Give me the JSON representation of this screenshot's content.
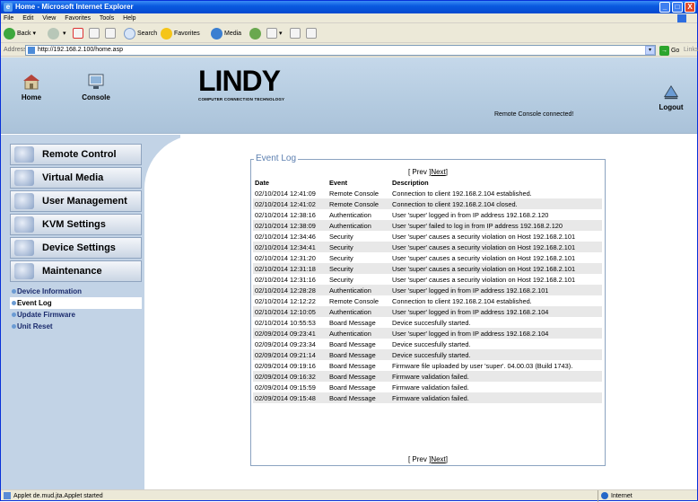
{
  "window": {
    "title": "Home - Microsoft Internet Explorer",
    "min": "_",
    "max": "□",
    "close": "X"
  },
  "menubar": [
    "File",
    "Edit",
    "View",
    "Favorites",
    "Tools",
    "Help"
  ],
  "toolbar": {
    "back": "Back",
    "search": "Search",
    "favorites": "Favorites",
    "media": "Media"
  },
  "address": {
    "label": "Address",
    "url": "http://192.168.2.100/home.asp",
    "go": "Go",
    "links": "Links"
  },
  "header": {
    "home": "Home",
    "console": "Console",
    "logo": "LINDY",
    "logo_sub": "COMPUTER CONNECTION TECHNOLOGY",
    "status": "Remote Console connected!",
    "logout": "Logout"
  },
  "sidebar": {
    "menus": [
      "Remote Control",
      "Virtual Media",
      "User Management",
      "KVM Settings",
      "Device Settings",
      "Maintenance"
    ],
    "subs": [
      "Device Information",
      "Event Log",
      "Update Firmware",
      "Unit Reset"
    ]
  },
  "eventlog": {
    "legend": "Event Log",
    "pager": {
      "prev": "[ Prev ]",
      "next": "Next",
      "close": "]"
    },
    "headers": [
      "Date",
      "Event",
      "Description"
    ],
    "rows": [
      [
        "02/10/2014 12:41:09",
        "Remote Console",
        "Connection to client 192.168.2.104 established."
      ],
      [
        "02/10/2014 12:41:02",
        "Remote Console",
        "Connection to client 192.168.2.104 closed."
      ],
      [
        "02/10/2014 12:38:16",
        "Authentication",
        "User 'super' logged in from IP address 192.168.2.120"
      ],
      [
        "02/10/2014 12:38:09",
        "Authentication",
        "User 'super' failed to log in from IP address 192.168.2.120"
      ],
      [
        "02/10/2014 12:34:46",
        "Security",
        "User 'super' causes a security violation on Host 192.168.2.101"
      ],
      [
        "02/10/2014 12:34:41",
        "Security",
        "User 'super' causes a security violation on Host 192.168.2.101"
      ],
      [
        "02/10/2014 12:31:20",
        "Security",
        "User 'super' causes a security violation on Host 192.168.2.101"
      ],
      [
        "02/10/2014 12:31:18",
        "Security",
        "User 'super' causes a security violation on Host 192.168.2.101"
      ],
      [
        "02/10/2014 12:31:16",
        "Security",
        "User 'super' causes a security violation on Host 192.168.2.101"
      ],
      [
        "02/10/2014 12:28:28",
        "Authentication",
        "User 'super' logged in from IP address 192.168.2.101"
      ],
      [
        "02/10/2014 12:12:22",
        "Remote Console",
        "Connection to client 192.168.2.104 established."
      ],
      [
        "02/10/2014 12:10:05",
        "Authentication",
        "User 'super' logged in from IP address 192.168.2.104"
      ],
      [
        "02/10/2014 10:55:53",
        "Board Message",
        "Device succesfully started."
      ],
      [
        "02/09/2014 09:23:41",
        "Authentication",
        "User 'super' logged in from IP address 192.168.2.104"
      ],
      [
        "02/09/2014 09:23:34",
        "Board Message",
        "Device succesfully started."
      ],
      [
        "02/09/2014 09:21:14",
        "Board Message",
        "Device succesfully started."
      ],
      [
        "02/09/2014 09:19:16",
        "Board Message",
        "Firmware file uploaded by user 'super'. 04.00.03 (Build 1743)."
      ],
      [
        "02/09/2014 09:16:32",
        "Board Message",
        "Firmware validation failed."
      ],
      [
        "02/09/2014 09:15:59",
        "Board Message",
        "Firmware validation failed."
      ],
      [
        "02/09/2014 09:15:48",
        "Board Message",
        "Firmware validation failed."
      ]
    ]
  },
  "statusbar": {
    "text": "Applet de.mud.jta.Applet started",
    "zone": "Internet"
  }
}
